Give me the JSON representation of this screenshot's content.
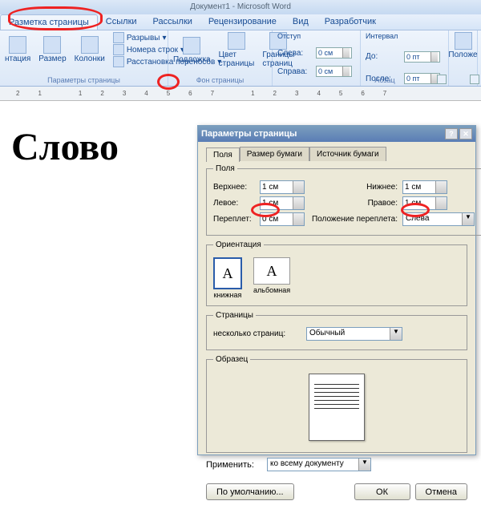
{
  "title": "Документ1 - Microsoft Word",
  "tabs": [
    "Разметка страницы",
    "Ссылки",
    "Рассылки",
    "Рецензирование",
    "Вид",
    "Разработчик"
  ],
  "ribbon": {
    "g1": {
      "items": [
        "нтация",
        "Размер",
        "Колонки"
      ],
      "side": [
        "Разрывы",
        "Номера строк",
        "Расстановка переносов"
      ],
      "label": "Параметры страницы"
    },
    "g2": {
      "items": [
        "Подложка",
        "Цвет страницы",
        "Границы страниц"
      ],
      "label": "Фон страницы"
    },
    "g3": {
      "title": "Отступ",
      "left_lbl": "Слева:",
      "left_val": "0 см",
      "right_lbl": "Справа:",
      "right_val": "0 см"
    },
    "g4": {
      "title": "Интервал",
      "before_lbl": "До:",
      "before_val": "0 пт",
      "after_lbl": "После:",
      "after_val": "0 пт",
      "label": "Абзац"
    },
    "g5": "Положе"
  },
  "ruler": [
    "2",
    "1",
    "",
    "1",
    "2",
    "3",
    "4",
    "5",
    "6",
    "7",
    "",
    "1",
    "2",
    "3",
    "4",
    "5",
    "6",
    "7"
  ],
  "doc_text": "Слово",
  "dialog": {
    "title": "Параметры страницы",
    "tabs": [
      "Поля",
      "Размер бумаги",
      "Источник бумаги"
    ],
    "fields": {
      "section": "Поля",
      "top_lbl": "Верхнее:",
      "top_val": "1 см",
      "bottom_lbl": "Нижнее:",
      "bottom_val": "1 см",
      "left_lbl": "Левое:",
      "left_val": "1 см",
      "right_lbl": "Правое:",
      "right_val": "1 см",
      "gutter_lbl": "Переплет:",
      "gutter_val": "0 см",
      "gutterpos_lbl": "Положение переплета:",
      "gutterpos_val": "Слева"
    },
    "orient": {
      "section": "Ориентация",
      "portrait": "книжная",
      "landscape": "альбомная"
    },
    "pages": {
      "section": "Страницы",
      "multi_lbl": "несколько страниц:",
      "multi_val": "Обычный"
    },
    "sample": "Образец",
    "apply_lbl": "Применить:",
    "apply_val": "ко всему документу",
    "default_btn": "По умолчанию...",
    "ok": "ОК",
    "cancel": "Отмена"
  }
}
